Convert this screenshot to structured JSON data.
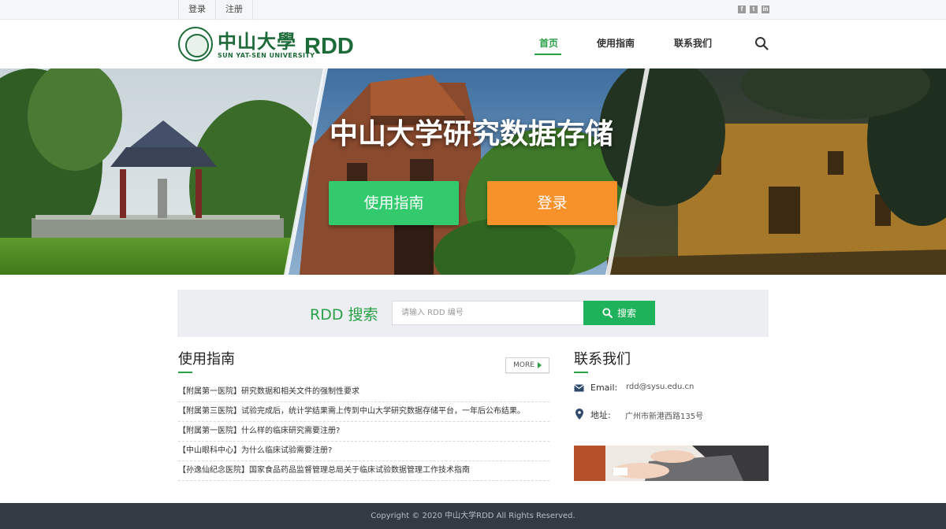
{
  "topbar": {
    "links": [
      "登录",
      "注册"
    ],
    "social": [
      "facebook-icon",
      "twitter-icon",
      "linkedin-icon"
    ]
  },
  "header": {
    "logo_cn": "中山大學",
    "logo_en": "SUN YAT-SEN UNIVERSITY",
    "logo_rdd": "RDD",
    "nav": {
      "home": "首页",
      "guide": "使用指南",
      "contact": "联系我们"
    },
    "search_icon": "search-icon"
  },
  "hero": {
    "title": "中山大学研究数据存储",
    "btn_guide": "使用指南",
    "btn_login": "登录"
  },
  "search": {
    "label": "RDD 搜索",
    "placeholder": "请输入 RDD 编号",
    "button": "搜索"
  },
  "guide": {
    "title": "使用指南",
    "more": "MORE",
    "items": [
      "【附属第一医院】研究数据和相关文件的强制性要求",
      "【附属第三医院】试验完成后，统计学结果需上传到中山大学研究数据存储平台，一年后公布结果。",
      "【附属第一医院】什么样的临床研究需要注册?",
      "【中山眼科中心】为什么临床试验需要注册?",
      "【孙逸仙纪念医院】国家食品药品监督管理总局关于临床试验数据管理工作技术指南"
    ]
  },
  "contact": {
    "title": "联系我们",
    "email_label": "Email:",
    "email": "rdd@sysu.edu.cn",
    "address_label": "地址:",
    "address": "广州市新港西路135号"
  },
  "footer": {
    "copyright": "Copyright © 2020 中山大学RDD All Rights Reserved."
  },
  "colors": {
    "brand_green": "#1e6b3a",
    "accent_green": "#2aa149",
    "login_orange": "#f7912a",
    "footer_bg": "#323a44"
  }
}
